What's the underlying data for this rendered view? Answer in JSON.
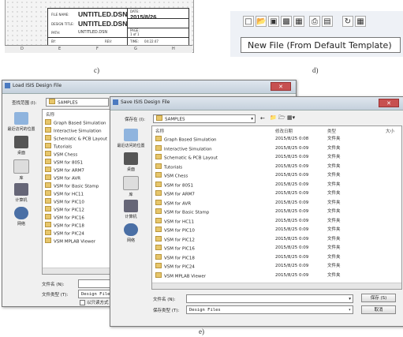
{
  "panel_c": {
    "caption": "c)",
    "title_block": {
      "file_name_label": "FILE NAME:",
      "file_name_value": "UNTITLED.DSN",
      "design_title_label": "DESIGN TITLE:",
      "design_title_value": "UNTITLED.DSN",
      "path_label": "PATH:",
      "path_value": "UNTITLED.DSN",
      "by_label": "BY:",
      "rev_label": "REV:",
      "date_label": "DATE:",
      "date_value": "2015/8/26",
      "page_label": "PAGE:",
      "page_value": "1    of    1",
      "time_label": "TIME:",
      "time_value": "04:22:47"
    },
    "ruler_marks": [
      "D",
      "E",
      "F",
      "G",
      "H"
    ]
  },
  "panel_d": {
    "caption": "d)",
    "tooltip": "New File (From Default Template)"
  },
  "panel_e": {
    "caption": "e)",
    "load_dialog": {
      "title": "Load ISIS Design File",
      "lookin_label": "查找范围 (I):",
      "lookin_value": "SAMPLES",
      "name_header": "名称",
      "places": [
        "最近访问的位置",
        "桌面",
        "库",
        "计算机",
        "网络"
      ],
      "files": [
        "Graph Based Simulation",
        "Interactive Simulation",
        "Schematic & PCB Layout",
        "Tutorials",
        "VSM Chess",
        "VSM for 8051",
        "VSM for ARM7",
        "VSM for AVR",
        "VSM for Basic Stamp",
        "VSM for HC11",
        "VSM for PIC10",
        "VSM for PIC12",
        "VSM for PIC16",
        "VSM for PIC18",
        "VSM for PIC24",
        "VSM MPLAB Viewer"
      ],
      "filename_label": "文件名 (N):",
      "filetype_label": "文件类型 (T):",
      "filetype_value": "Design Files",
      "readonly_label": "以只读方式"
    },
    "save_dialog": {
      "title": "Save ISIS Design File",
      "savein_label": "保存在 (I):",
      "savein_value": "SAMPLES",
      "headers": {
        "name": "名称",
        "modified": "修改日期",
        "type": "类型",
        "size": "大小"
      },
      "places": [
        "最近访问的位置",
        "桌面",
        "库",
        "计算机",
        "网络"
      ],
      "files": [
        {
          "name": "Graph Based Simulation",
          "date": "2015/8/25 0:08",
          "type": "文件夹"
        },
        {
          "name": "Interactive Simulation",
          "date": "2015/8/25 0:09",
          "type": "文件夹"
        },
        {
          "name": "Schematic & PCB Layout",
          "date": "2015/8/25 0:09",
          "type": "文件夹"
        },
        {
          "name": "Tutorials",
          "date": "2015/8/25 0:09",
          "type": "文件夹"
        },
        {
          "name": "VSM Chess",
          "date": "2015/8/25 0:09",
          "type": "文件夹"
        },
        {
          "name": "VSM for 8051",
          "date": "2015/8/25 0:09",
          "type": "文件夹"
        },
        {
          "name": "VSM for ARM7",
          "date": "2015/8/25 0:09",
          "type": "文件夹"
        },
        {
          "name": "VSM for AVR",
          "date": "2015/8/25 0:09",
          "type": "文件夹"
        },
        {
          "name": "VSM for Basic Stamp",
          "date": "2015/8/25 0:09",
          "type": "文件夹"
        },
        {
          "name": "VSM for HC11",
          "date": "2015/8/25 0:09",
          "type": "文件夹"
        },
        {
          "name": "VSM for PIC10",
          "date": "2015/8/25 0:09",
          "type": "文件夹"
        },
        {
          "name": "VSM for PIC12",
          "date": "2015/8/25 0:09",
          "type": "文件夹"
        },
        {
          "name": "VSM for PIC16",
          "date": "2015/8/25 0:09",
          "type": "文件夹"
        },
        {
          "name": "VSM for PIC18",
          "date": "2015/8/25 0:09",
          "type": "文件夹"
        },
        {
          "name": "VSM for PIC24",
          "date": "2015/8/25 0:09",
          "type": "文件夹"
        },
        {
          "name": "VSM MPLAB Viewer",
          "date": "2015/8/25 0:09",
          "type": "文件夹"
        }
      ],
      "filename_label": "文件名 (N):",
      "filetype_label": "保存类型 (T):",
      "filetype_value": "Design Files",
      "save_button": "保存 (S)",
      "cancel_button": "取消"
    }
  },
  "colors": {
    "folder": "#e7c66b",
    "titlebar": "#c4d0dc",
    "close": "#c75050",
    "selection": "#cfe3f7"
  }
}
